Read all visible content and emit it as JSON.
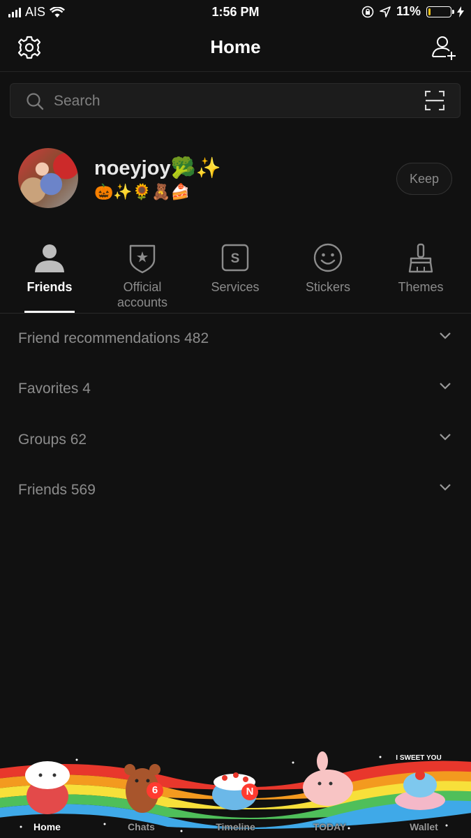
{
  "status_bar": {
    "carrier": "AIS",
    "time": "1:56 PM",
    "battery_percent": "11%",
    "battery_level": 0.11,
    "battery_color": "#f5c518"
  },
  "header": {
    "title": "Home",
    "left_icon": "gear-icon",
    "right_icon": "add-friend-icon"
  },
  "search": {
    "placeholder": "Search",
    "value": "",
    "scan_icon": "qr-scan-icon"
  },
  "profile": {
    "name": "noeyjoy🥦✨",
    "status": "🎃✨🌻🧸🍰",
    "keep_label": "Keep"
  },
  "tabs": [
    {
      "label": "Friends",
      "icon": "person-icon",
      "active": true
    },
    {
      "label": "Official accounts",
      "icon": "shield-star-icon",
      "active": false
    },
    {
      "label": "Services",
      "icon": "services-icon",
      "active": false
    },
    {
      "label": "Stickers",
      "icon": "smiley-icon",
      "active": false
    },
    {
      "label": "Themes",
      "icon": "brush-icon",
      "active": false
    }
  ],
  "list": [
    {
      "label": "Friend recommendations 482"
    },
    {
      "label": "Favorites 4"
    },
    {
      "label": "Groups 62"
    },
    {
      "label": "Friends 569"
    }
  ],
  "bottom_nav": [
    {
      "label": "Home",
      "active": true,
      "badge": ""
    },
    {
      "label": "Chats",
      "active": false,
      "badge": "6"
    },
    {
      "label": "Timeline",
      "active": false,
      "badge": "N"
    },
    {
      "label": "TODAY",
      "active": false,
      "badge": ""
    },
    {
      "label": "Wallet",
      "active": false,
      "badge": ""
    }
  ],
  "bottom_art_text": "I SWEET YOU",
  "colors": {
    "background": "#111111",
    "inactive_text": "#8c8c8c",
    "badge": "#ff3b30"
  }
}
